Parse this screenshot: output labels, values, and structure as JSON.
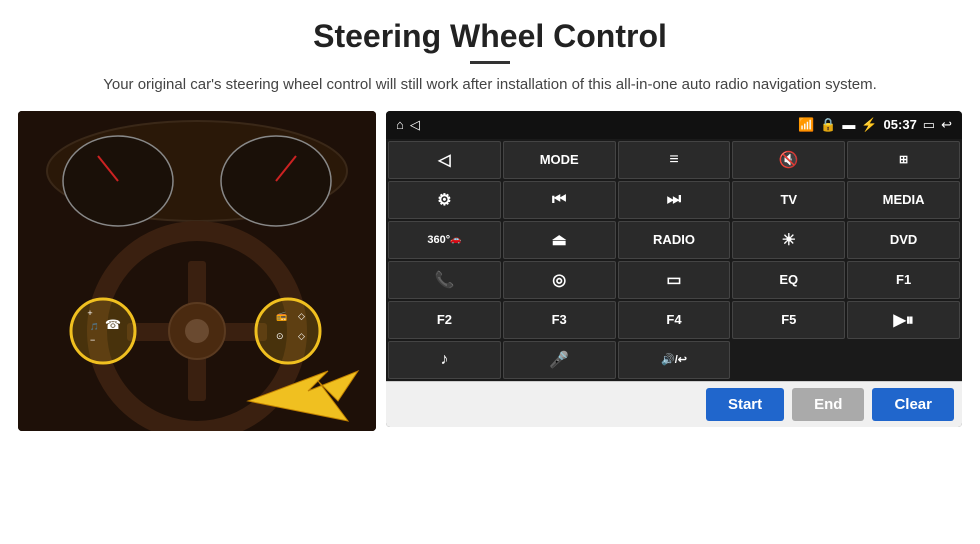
{
  "header": {
    "title": "Steering Wheel Control",
    "subtitle": "Your original car's steering wheel control will still work after installation of this all-in-one auto radio navigation system."
  },
  "status_bar": {
    "time": "05:37",
    "icons": [
      "home",
      "wifi",
      "lock",
      "sim",
      "bluetooth",
      "screen"
    ]
  },
  "buttons": [
    {
      "id": "b1",
      "label": "▲",
      "type": "icon",
      "row": 1
    },
    {
      "id": "b2",
      "label": "MODE",
      "type": "text",
      "row": 1
    },
    {
      "id": "b3",
      "label": "≡",
      "type": "icon",
      "row": 1
    },
    {
      "id": "b4",
      "label": "🔇",
      "type": "icon",
      "row": 1
    },
    {
      "id": "b5",
      "label": "⊞",
      "type": "icon",
      "row": 1
    },
    {
      "id": "b6",
      "label": "⚙",
      "type": "icon",
      "row": 2
    },
    {
      "id": "b7",
      "label": "⏮",
      "type": "icon",
      "row": 2
    },
    {
      "id": "b8",
      "label": "⏭",
      "type": "icon",
      "row": 2
    },
    {
      "id": "b9",
      "label": "TV",
      "type": "text",
      "row": 2
    },
    {
      "id": "b10",
      "label": "MEDIA",
      "type": "text",
      "row": 2
    },
    {
      "id": "b11",
      "label": "360°",
      "type": "text",
      "row": 3
    },
    {
      "id": "b12",
      "label": "⏏",
      "type": "icon",
      "row": 3
    },
    {
      "id": "b13",
      "label": "RADIO",
      "type": "text",
      "row": 3
    },
    {
      "id": "b14",
      "label": "☀",
      "type": "icon",
      "row": 3
    },
    {
      "id": "b15",
      "label": "DVD",
      "type": "text",
      "row": 3
    },
    {
      "id": "b16",
      "label": "📞",
      "type": "icon",
      "row": 4
    },
    {
      "id": "b17",
      "label": "◎",
      "type": "icon",
      "row": 4
    },
    {
      "id": "b18",
      "label": "▭",
      "type": "icon",
      "row": 4
    },
    {
      "id": "b19",
      "label": "EQ",
      "type": "text",
      "row": 4
    },
    {
      "id": "b20",
      "label": "F1",
      "type": "text",
      "row": 4
    },
    {
      "id": "b21",
      "label": "F2",
      "type": "text",
      "row": 5
    },
    {
      "id": "b22",
      "label": "F3",
      "type": "text",
      "row": 5
    },
    {
      "id": "b23",
      "label": "F4",
      "type": "text",
      "row": 5
    },
    {
      "id": "b24",
      "label": "F5",
      "type": "text",
      "row": 5
    },
    {
      "id": "b25",
      "label": "▶⏸",
      "type": "icon",
      "row": 5
    },
    {
      "id": "b26",
      "label": "♪",
      "type": "icon",
      "row": 6
    },
    {
      "id": "b27",
      "label": "🎤",
      "type": "icon",
      "row": 6
    },
    {
      "id": "b28",
      "label": "🔊/↩",
      "type": "icon",
      "row": 6
    }
  ],
  "bottom_buttons": {
    "start": "Start",
    "end": "End",
    "clear": "Clear"
  }
}
